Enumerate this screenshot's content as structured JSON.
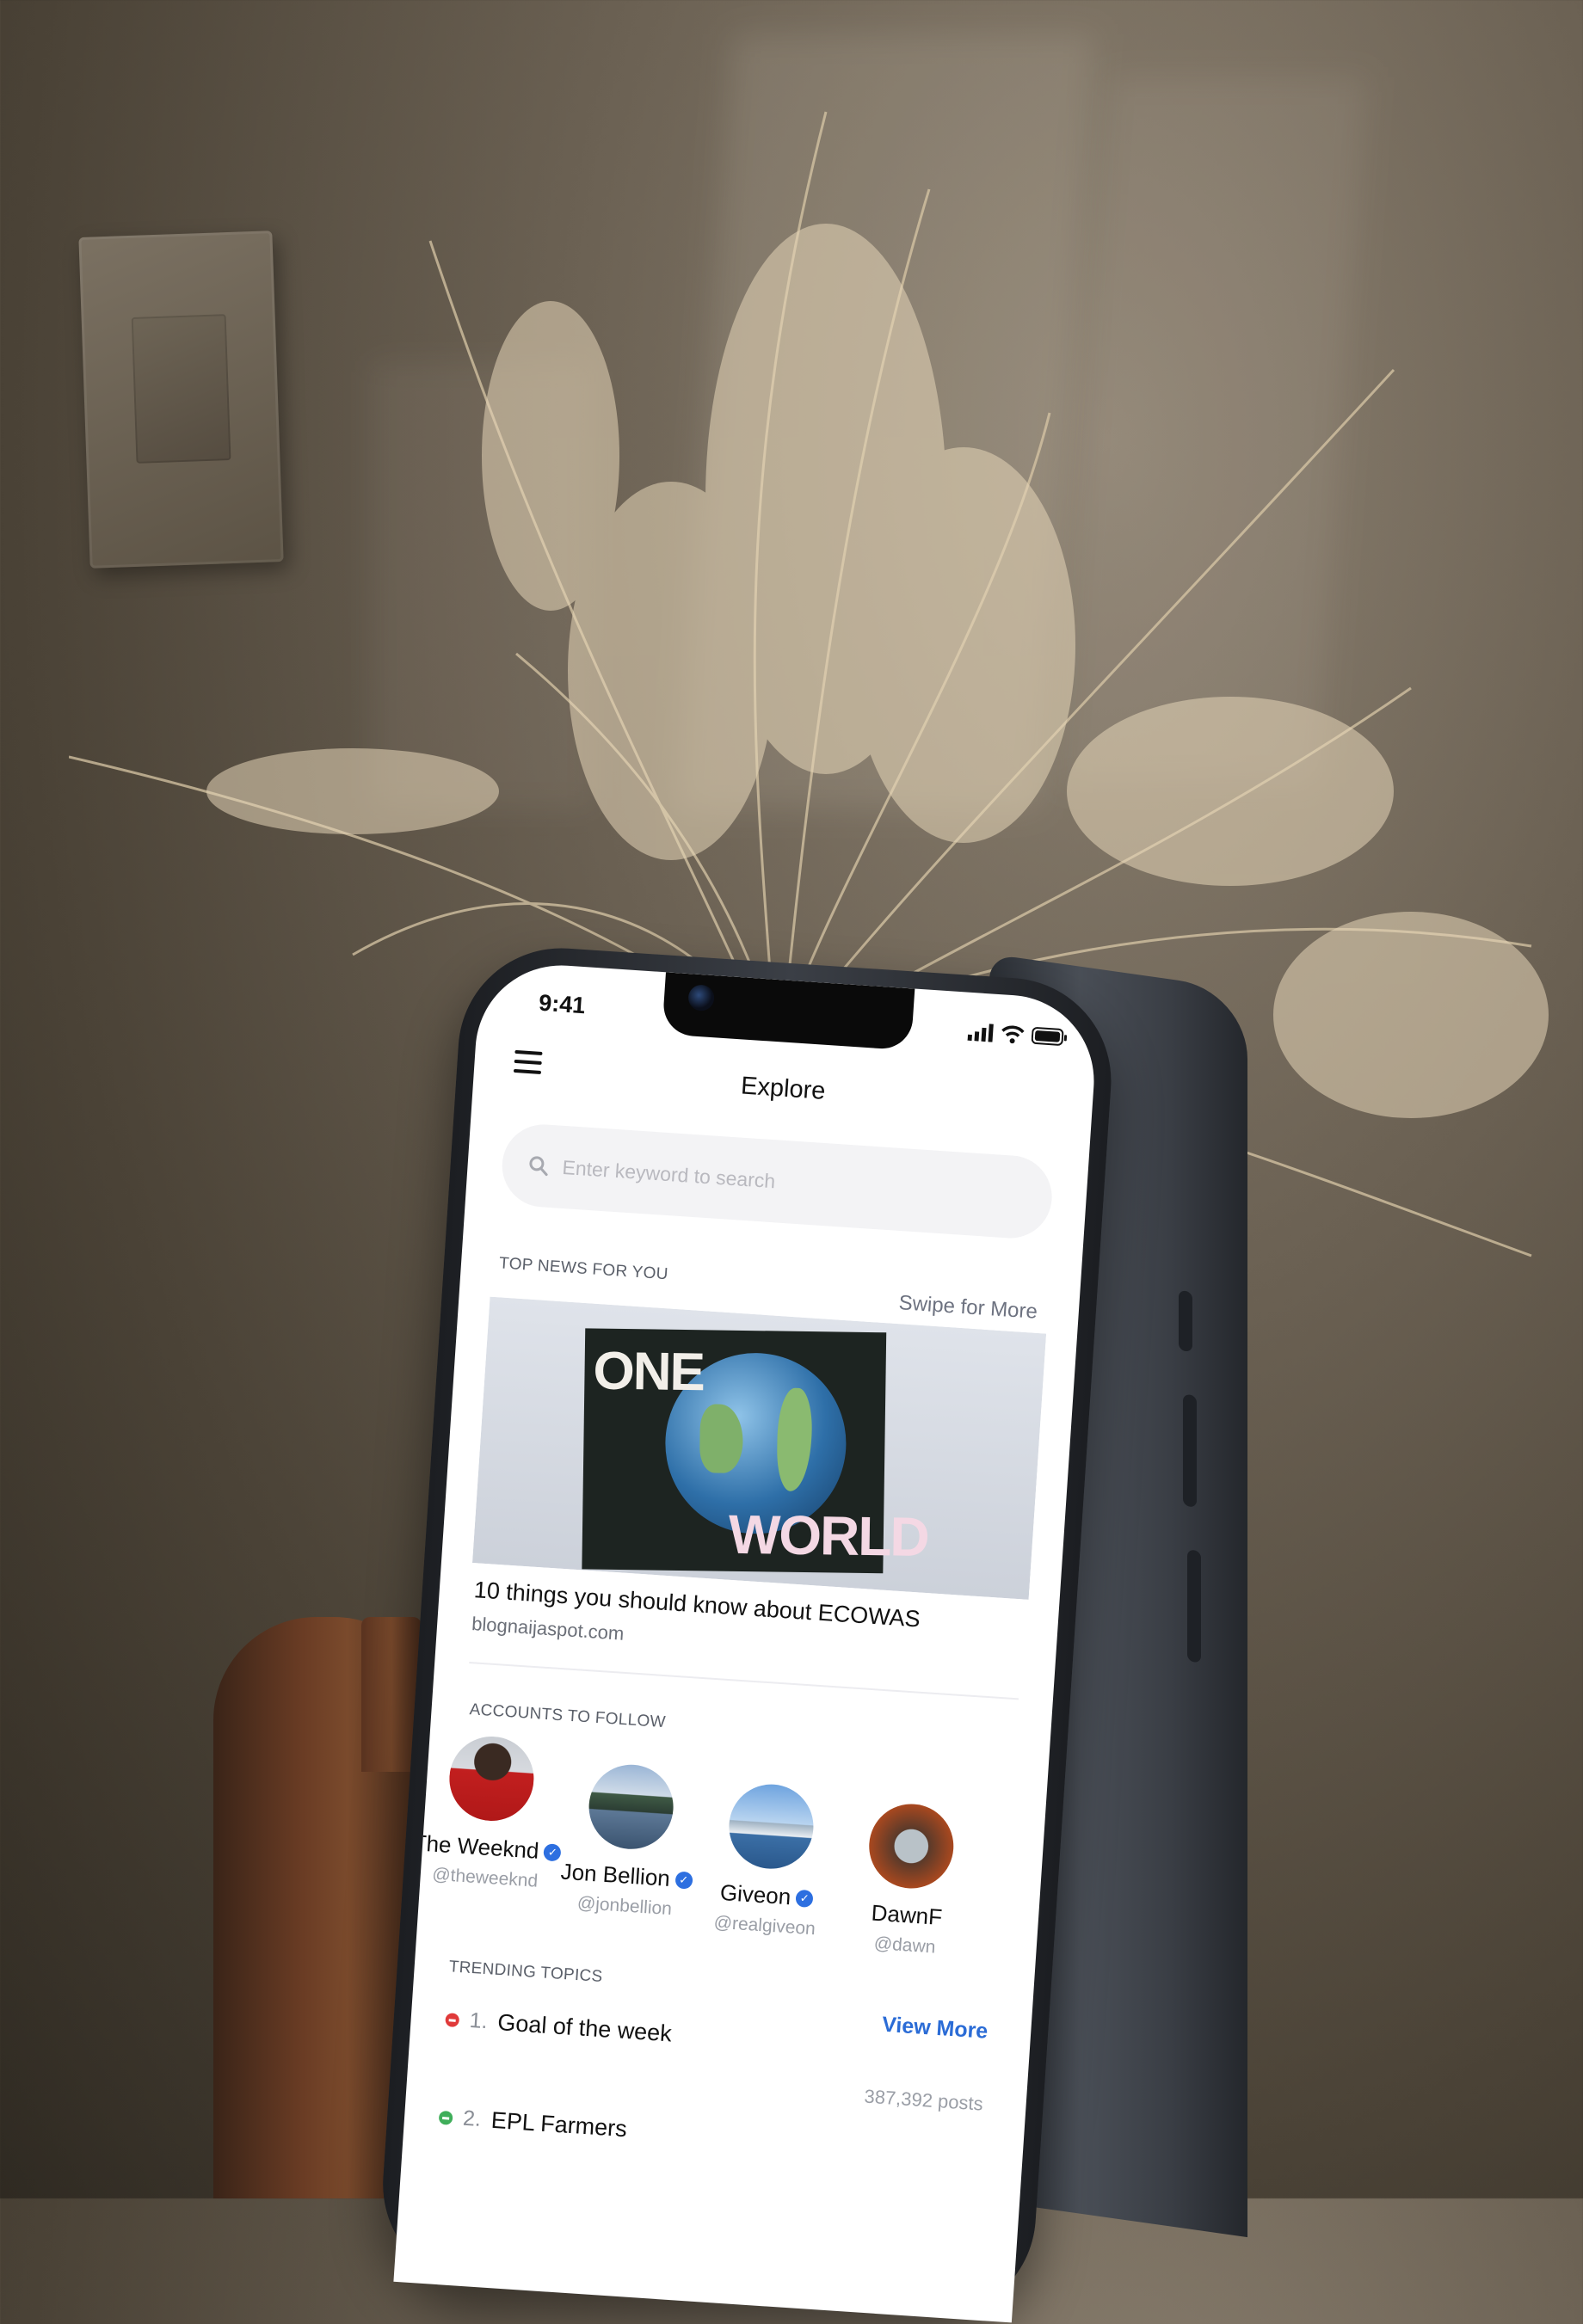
{
  "status_bar": {
    "time": "9:41"
  },
  "header": {
    "title": "Explore"
  },
  "search": {
    "placeholder": "Enter keyword to search"
  },
  "top_news": {
    "section_label": "TOP NEWS FOR YOU",
    "swipe_label": "Swipe for More",
    "image_text_one": "ONE",
    "image_text_world": "WORLD",
    "headline": "10 things you should know about ECOWAS",
    "source": "blognaijaspot.com"
  },
  "accounts": {
    "section_label": "ACCOUNTS TO FOLLOW",
    "items": [
      {
        "name": "The Weeknd",
        "handle": "@theweeknd",
        "verified": true
      },
      {
        "name": "Jon Bellion",
        "handle": "@jonbellion",
        "verified": true
      },
      {
        "name": "Giveon",
        "handle": "@realgiveon",
        "verified": true
      },
      {
        "name": "DawnF",
        "handle": "@dawn",
        "verified": false
      }
    ]
  },
  "trending": {
    "section_label": "TRENDING TOPICS",
    "view_more": "View More",
    "items": [
      {
        "rank": "1.",
        "name": "Goal of the week",
        "posts": "387,392 posts",
        "indicator_color": "#e03a3a"
      },
      {
        "rank": "2.",
        "name": "EPL Farmers",
        "posts": "",
        "indicator_color": "#3fae5a"
      }
    ]
  },
  "colors": {
    "accent": "#2b6cd6",
    "verified": "#2d6fe0"
  }
}
